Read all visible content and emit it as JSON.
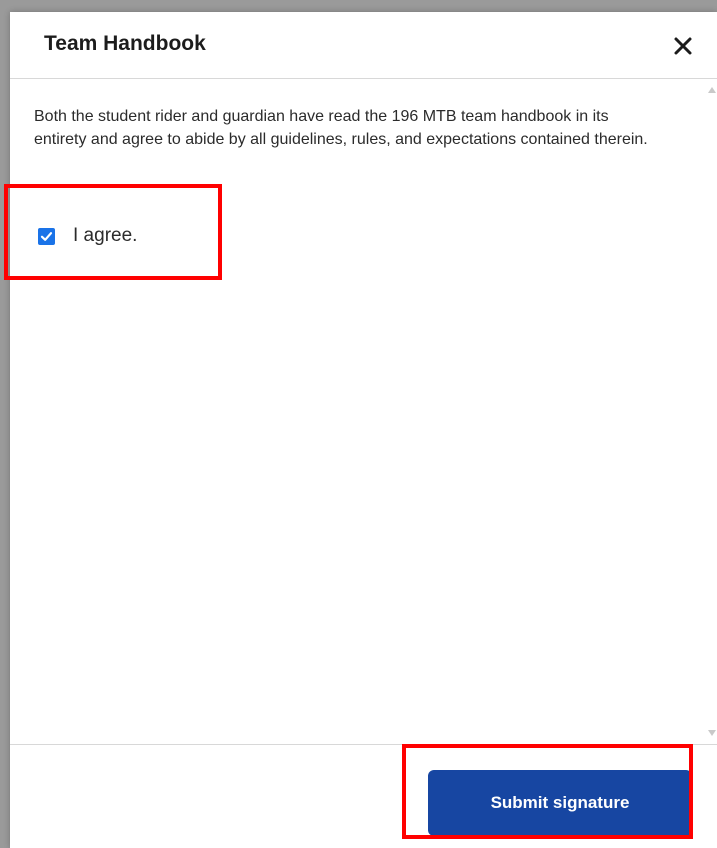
{
  "modal": {
    "title": "Team Handbook",
    "close_icon": "close-icon",
    "body_text": "Both the student rider and guardian have read the 196 MTB team handbook in its entirety and agree to abide by all guidelines, rules, and expectations contained therein.",
    "checkbox": {
      "label": "I agree.",
      "checked": true,
      "icon": "checkmark-icon"
    },
    "submit_label": "Submit signature"
  },
  "colors": {
    "accent": "#1a73e8",
    "submit_bg": "#1746a2",
    "highlight": "#ff0000"
  }
}
